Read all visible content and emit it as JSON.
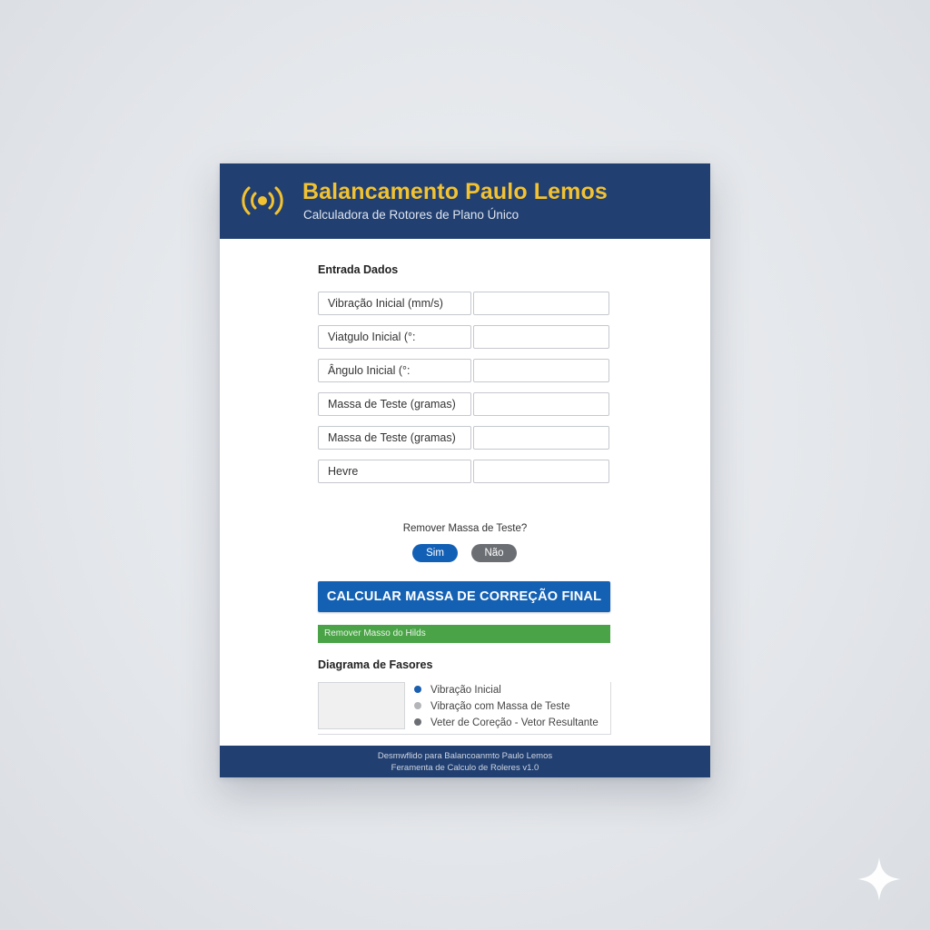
{
  "header": {
    "title": "Balancamento Paulo Lemos",
    "subtitle": "Calculadora de Rotores de Plano Único",
    "logo_icon": "vibration-signal-icon",
    "colors": {
      "background": "#213f70",
      "title": "#f2c232"
    }
  },
  "input_section": {
    "title": "Entrada Dados",
    "fields": [
      {
        "label": "Vibração Inicial (mm/s)",
        "value": ""
      },
      {
        "label": "Viatgulo Inicial (°:",
        "value": ""
      },
      {
        "label": "Ângulo Inicial (°:",
        "value": ""
      },
      {
        "label": "Massa de Teste (gramas)",
        "value": ""
      },
      {
        "label": "Massa de Teste (gramas)",
        "value": ""
      },
      {
        "label": "Hevre",
        "value": ""
      }
    ]
  },
  "remove_test_mass": {
    "question": "Remover Massa de Teste?",
    "yes_label": "Sim",
    "no_label": "Não",
    "yes_color": "#1260b6",
    "no_color": "#6b6e73"
  },
  "calculate_button": {
    "label": "CALCULAR MASSA DE CORREÇÃO FINAL",
    "color": "#1461b4"
  },
  "status_bar": {
    "text": "Remover Masso do Hilds",
    "color": "#4aa447"
  },
  "diagram": {
    "title": "Diagrama de Fasores",
    "legend": [
      {
        "label": "Vibração Inicial",
        "color": "#1a5fb0"
      },
      {
        "label": "Vibração com Massa de Teste",
        "color": "#b3b5b8"
      },
      {
        "label": "Veter de Coreção - Vetor Resultante",
        "color": "#6b6e73"
      }
    ]
  },
  "footer": {
    "line1": "Desmwflido para Balancoanmto Paulo Lemos",
    "line2": "Feramenta de Calculo de Roleres v1.0"
  }
}
